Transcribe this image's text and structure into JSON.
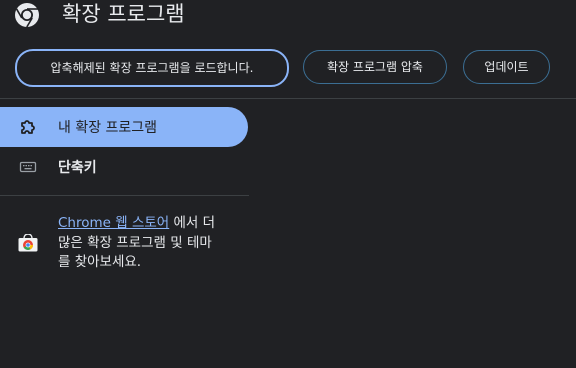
{
  "header": {
    "title": "확장 프로그램",
    "logo_icon": "chrome-logo-icon"
  },
  "toolbar": {
    "load_unpacked_label": "압축해제된 확장 프로그램을 로드합니다.",
    "pack_label": "확장 프로그램 압축",
    "update_label": "업데이트"
  },
  "sidebar": {
    "items": [
      {
        "label": "내 확장 프로그램",
        "icon": "puzzle-icon",
        "active": true
      },
      {
        "label": "단축키",
        "icon": "keyboard-icon",
        "active": false
      }
    ],
    "store": {
      "icon": "chrome-web-store-icon",
      "link_text": "Chrome 웹 스토어",
      "text_line1_rest": "에서 더",
      "text_line2": "많은 확장 프로그램 및 테마",
      "text_line3": "를 찾아보세요."
    }
  },
  "colors": {
    "background": "#202124",
    "accent": "#8ab4f8",
    "button_border": "#3b6e93",
    "divider": "#3c4043"
  }
}
